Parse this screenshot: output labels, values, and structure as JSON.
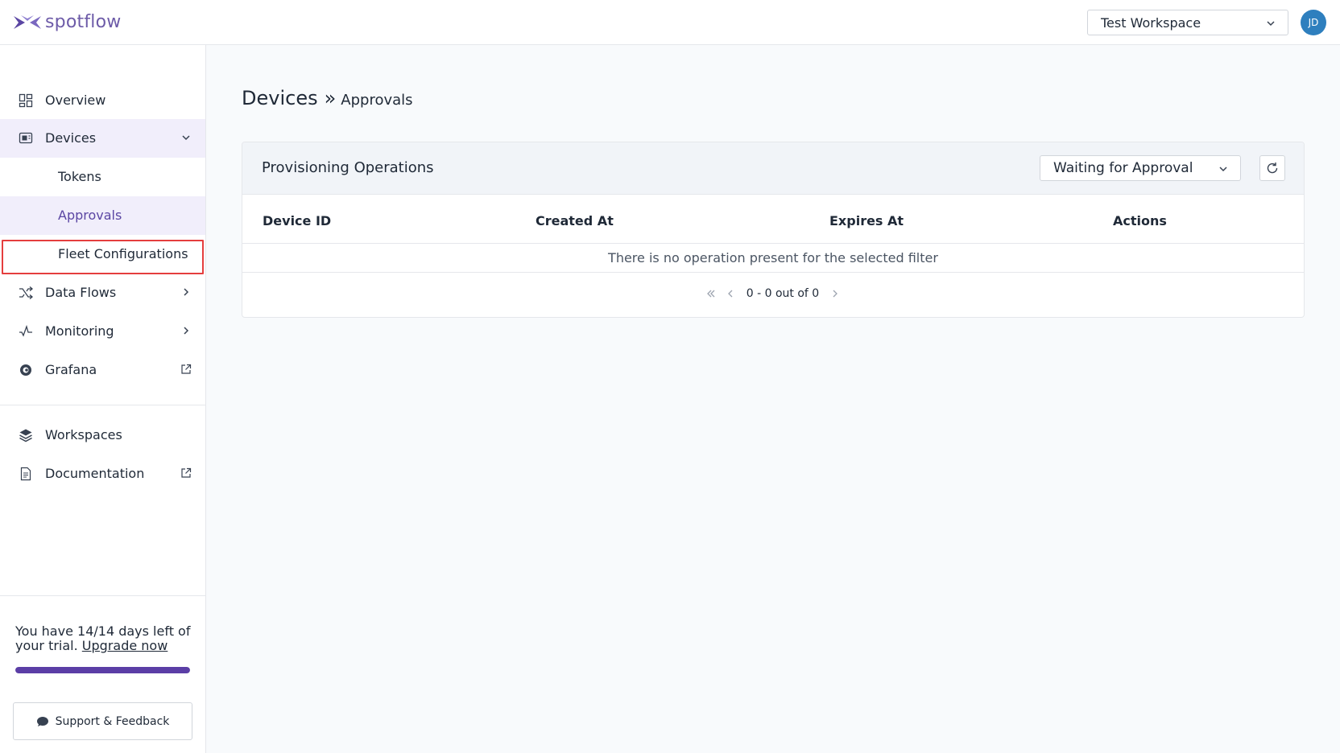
{
  "header": {
    "logo_text": "spotflow",
    "workspace_selected": "Test Workspace",
    "avatar_initials": "JD"
  },
  "sidebar": {
    "items": [
      {
        "label": "Overview",
        "icon": "grid-icon"
      },
      {
        "label": "Devices",
        "icon": "device-icon",
        "expanded": true
      },
      {
        "label": "Tokens"
      },
      {
        "label": "Approvals",
        "active": true
      },
      {
        "label": "Fleet Configurations"
      },
      {
        "label": "Data Flows",
        "icon": "shuffle-icon"
      },
      {
        "label": "Monitoring",
        "icon": "activity-icon"
      },
      {
        "label": "Grafana",
        "icon": "grafana-icon",
        "external": true
      }
    ],
    "bottom_items": [
      {
        "label": "Workspaces",
        "icon": "layers-icon"
      },
      {
        "label": "Documentation",
        "icon": "document-icon",
        "external": true
      }
    ],
    "trial": {
      "text": "You have 14/14 days left of your trial.",
      "link": "Upgrade now",
      "progress": 1.0
    },
    "support_label": "Support & Feedback"
  },
  "breadcrumb": {
    "main": "Devices",
    "separator": "»",
    "sub": "Approvals"
  },
  "panel": {
    "title": "Provisioning Operations",
    "filter_selected": "Waiting for Approval",
    "columns": [
      "Device ID",
      "Created At",
      "Expires At",
      "Actions"
    ],
    "empty_message": "There is no operation present for the selected filter",
    "pagination": "0 - 0 out of 0"
  },
  "colors": {
    "brand": "#6d5ba8",
    "active_bg": "#f1eefb",
    "highlight_border": "#e53e3e",
    "avatar_bg": "#2e7fbe",
    "trial_bar": "#5b3ea6"
  }
}
